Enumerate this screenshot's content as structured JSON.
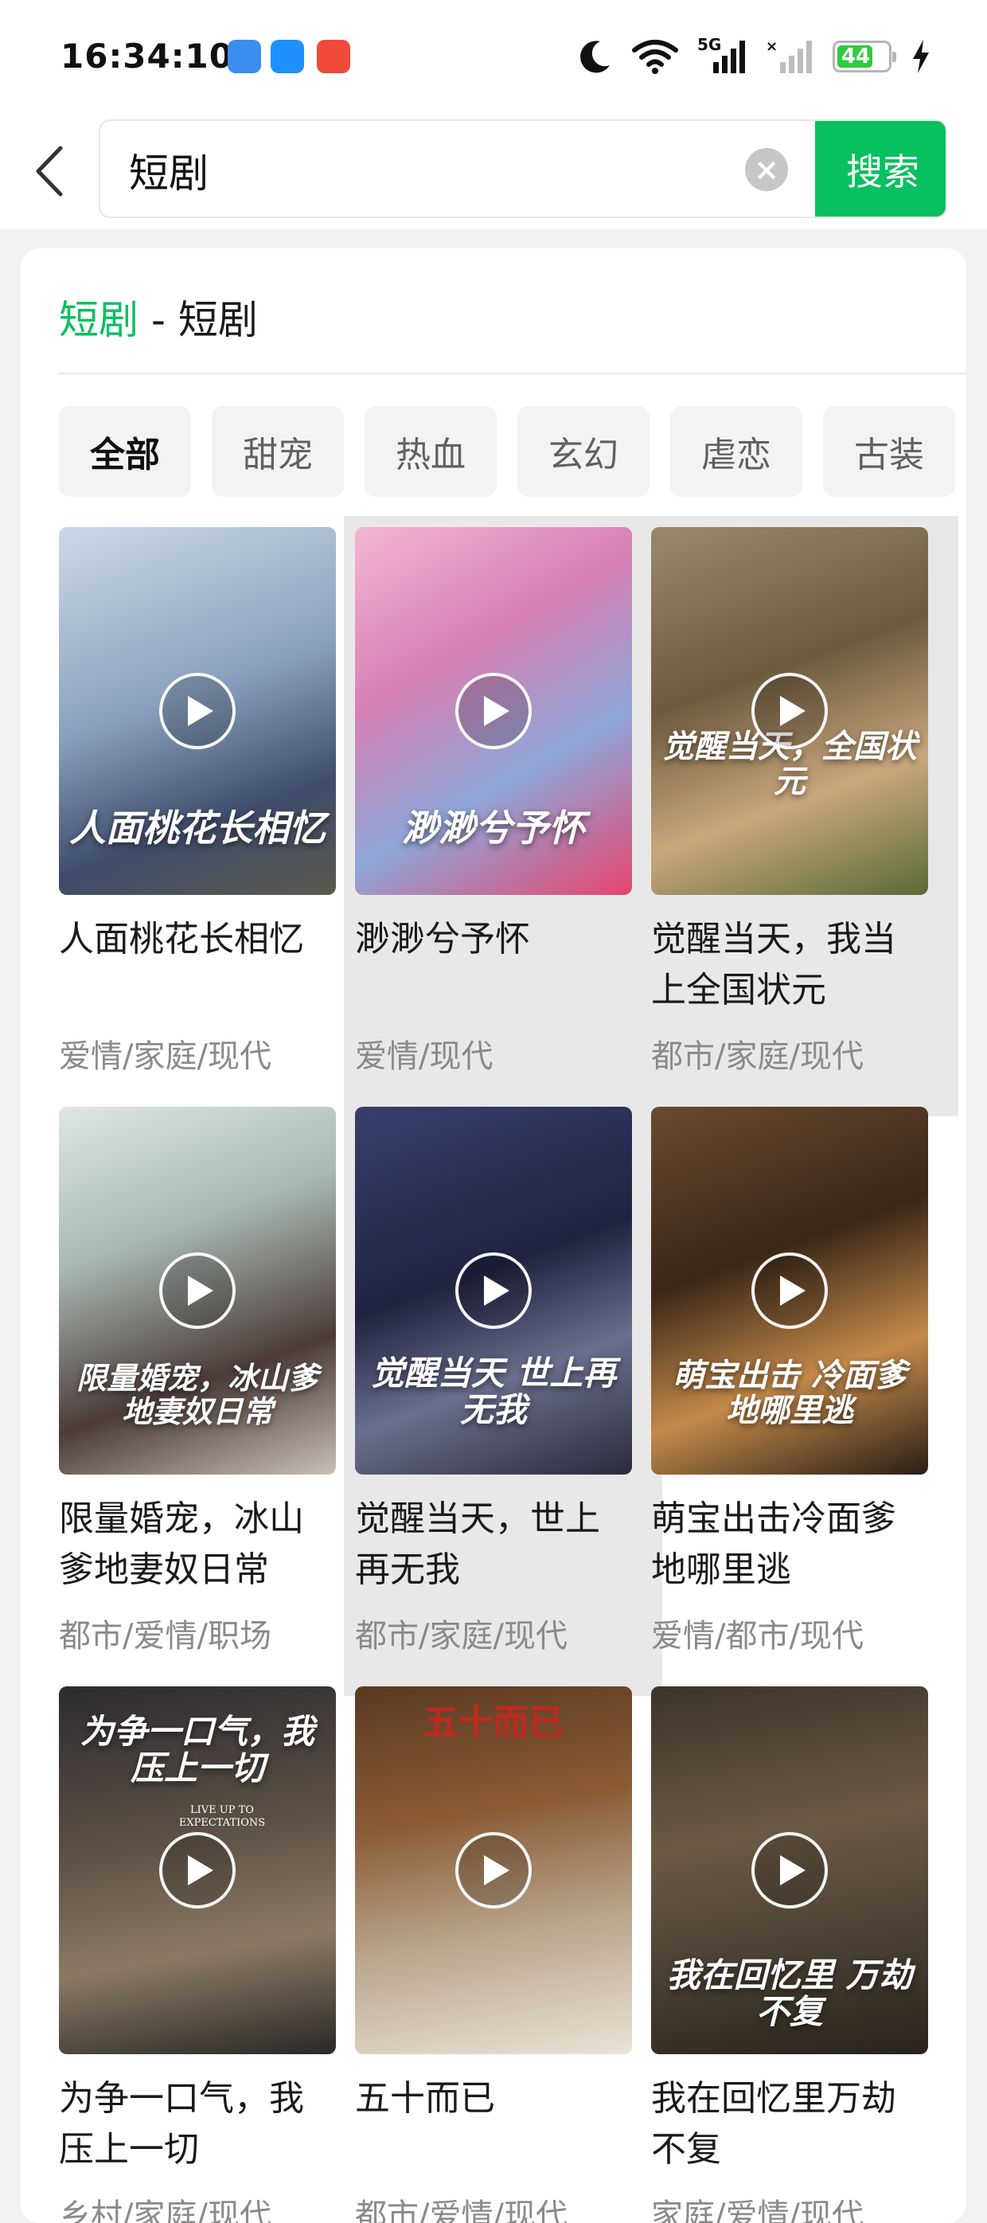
{
  "status_bar": {
    "time": "16:34:10",
    "network_label": "5G",
    "battery_level": "44",
    "icons": [
      "moon-icon",
      "wifi-icon",
      "signal-5g-icon",
      "signal-no-sim-icon",
      "battery-icon",
      "charging-icon"
    ],
    "app_icon_colors": [
      "#3b8df0",
      "#1e90ff",
      "#f04a3a"
    ]
  },
  "search": {
    "query": "短剧",
    "button_label": "搜索",
    "back_icon": "chevron-left-icon",
    "clear_icon": "×"
  },
  "result": {
    "title_accent": "短剧",
    "title_rest": " - 短剧"
  },
  "filters": [
    {
      "label": "全部",
      "active": true
    },
    {
      "label": "甜宠",
      "active": false
    },
    {
      "label": "热血",
      "active": false
    },
    {
      "label": "玄幻",
      "active": false
    },
    {
      "label": "虐恋",
      "active": false
    },
    {
      "label": "古装",
      "active": false
    }
  ],
  "items": [
    {
      "name": "人面桃花长相忆",
      "tags": "爱情/家庭/现代",
      "poster_text": "人面桃花长相忆"
    },
    {
      "name": "渺渺兮予怀",
      "tags": "爱情/现代",
      "poster_text": "渺渺兮予怀"
    },
    {
      "name": "觉醒当天，我当上全国状元",
      "tags": "都市/家庭/现代",
      "poster_text": "觉醒当天，全国状元"
    },
    {
      "name": "限量婚宠，冰山爹地妻奴日常",
      "tags": "都市/爱情/职场",
      "poster_text": "限量婚宠，冰山爹地妻奴日常"
    },
    {
      "name": "觉醒当天，世上再无我",
      "tags": "都市/家庭/现代",
      "poster_text": "觉醒当天 世上再无我"
    },
    {
      "name": "萌宝出击冷面爹地哪里逃",
      "tags": "爱情/都市/现代",
      "poster_text": "萌宝出击 冷面爹地哪里逃"
    },
    {
      "name": "为争一口气，我压上一切",
      "tags": "乡村/家庭/现代",
      "poster_text": "为争一口气，我压上一切",
      "poster_subtext": "LIVE UP TO EXPECTATIONS"
    },
    {
      "name": "五十而已",
      "tags": "都市/爱情/现代",
      "poster_text": "五十而已"
    },
    {
      "name": "我在回忆里万劫不复",
      "tags": "家庭/爱情/现代",
      "poster_text": "我在回忆里 万劫不复"
    }
  ],
  "colors": {
    "accent": "#07c160",
    "card_bg": "#ffffff",
    "page_bg": "#f2f2f2",
    "highlight": "#e8e8e8"
  }
}
